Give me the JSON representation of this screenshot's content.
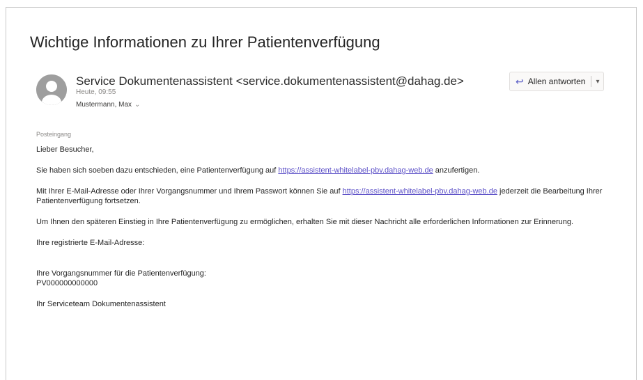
{
  "email": {
    "subject": "Wichtige Informationen zu Ihrer Patientenverfügung",
    "sender": "Service Dokumentenassistent <service.dokumentenassistent@dahag.de>",
    "date": "Heute, 09:55",
    "recipient": "Mustermann, Max",
    "folder": "Posteingang",
    "reply_all_label": "Allen antworten",
    "body": {
      "greeting": "Lieber Besucher,",
      "p1_before": "Sie haben sich soeben dazu entschieden, eine Patientenverfügung auf ",
      "p1_link": "https://assistent-whitelabel-pbv.dahag-web.de",
      "p1_after": " anzufertigen.",
      "p2_before": "Mit Ihrer E-Mail-Adresse oder Ihrer Vorgangsnummer und Ihrem Passwort können Sie auf ",
      "p2_link": "https://assistent-whitelabel-pbv.dahag-web.de",
      "p2_after": " jederzeit die Bearbeitung Ihrer Patientenverfügung fortsetzen.",
      "p3": "Um Ihnen den späteren Einstieg in Ihre Patientenverfügung zu ermöglichen, erhalten Sie mit dieser Nachricht alle erforderlichen Informationen zur Erinnerung.",
      "email_label": "Ihre registrierte E-Mail-Adresse:",
      "vorgang_label": "Ihre Vorgangsnummer für die Patientenverfügung:",
      "vorgang_number": "PV000000000000",
      "signature": "Ihr Serviceteam Dokumentenassistent"
    }
  },
  "icons": {
    "avatar": "person-avatar-icon",
    "reply_all": "reply-all-icon",
    "dropdown": "chevron-down-icon"
  },
  "colors": {
    "link": "#5b4fc7",
    "accent": "#5b5fc7"
  }
}
